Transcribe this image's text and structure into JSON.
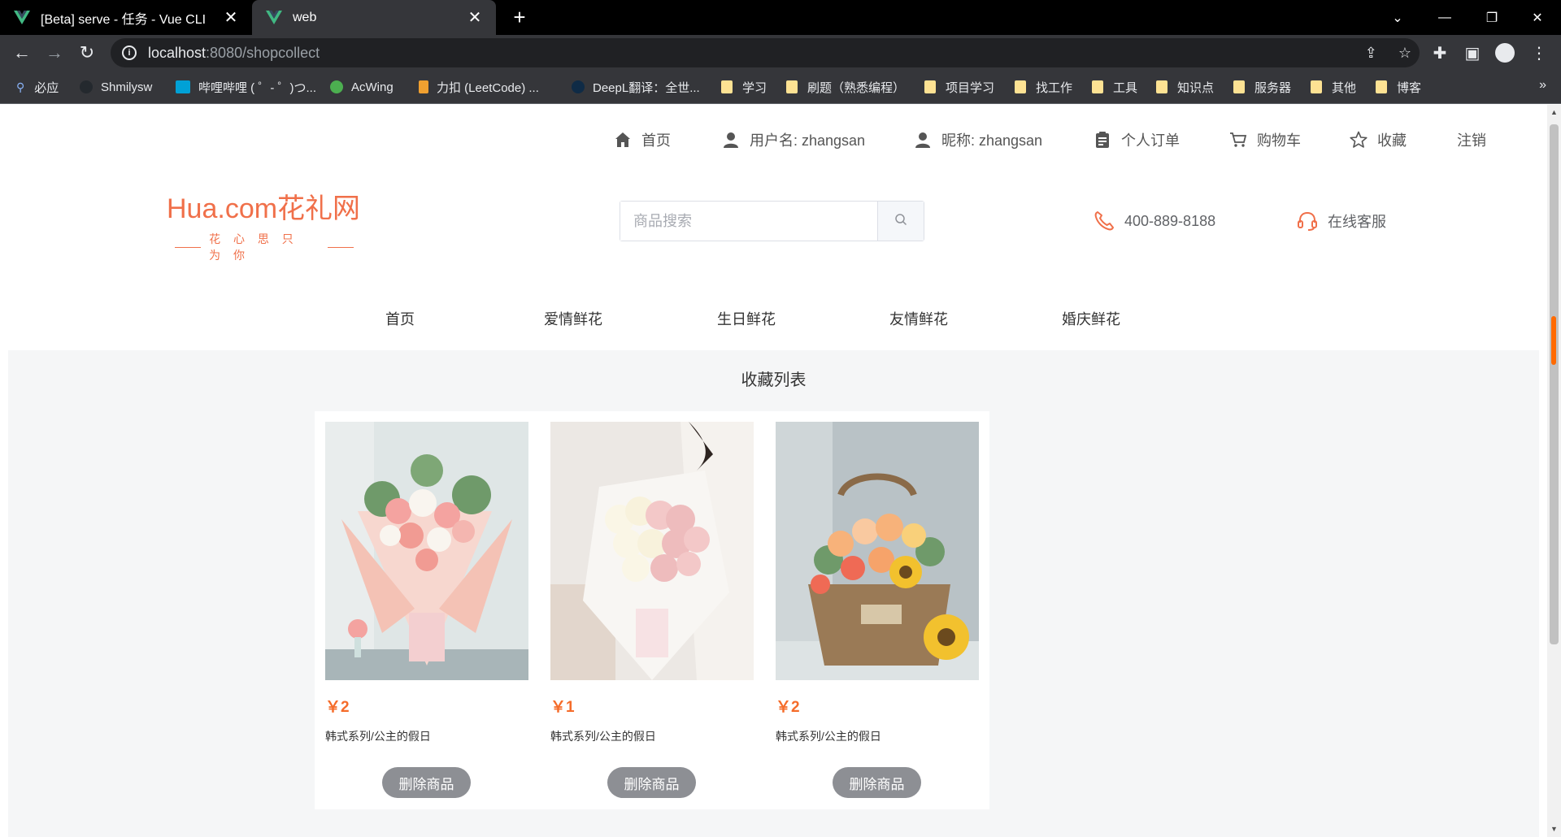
{
  "browser": {
    "tabs": [
      {
        "title": "[Beta] serve - 任务 - Vue CLI",
        "active": false
      },
      {
        "title": "web",
        "active": true
      }
    ],
    "url_host": "localhost",
    "url_path": ":8080/shopcollect",
    "bookmarks": [
      {
        "label": "必应",
        "icon": "search-icon"
      },
      {
        "label": "Shmilysw",
        "icon": "github-icon"
      },
      {
        "label": "哔哩哔哩 ( ゜- ゜)つ...",
        "icon": "bilibili-icon"
      },
      {
        "label": "AcWing",
        "icon": "acwing-icon"
      },
      {
        "label": "力扣 (LeetCode) ...",
        "icon": "leetcode-icon"
      },
      {
        "label": "DeepL翻译：全世...",
        "icon": "deepl-icon"
      },
      {
        "label": "学习",
        "icon": "folder-icon"
      },
      {
        "label": "刷题（熟悉编程）",
        "icon": "folder-icon"
      },
      {
        "label": "项目学习",
        "icon": "folder-icon"
      },
      {
        "label": "找工作",
        "icon": "folder-icon"
      },
      {
        "label": "工具",
        "icon": "folder-icon"
      },
      {
        "label": "知识点",
        "icon": "folder-icon"
      },
      {
        "label": "服务器",
        "icon": "folder-icon"
      },
      {
        "label": "其他",
        "icon": "folder-icon"
      },
      {
        "label": "博客",
        "icon": "folder-icon"
      }
    ]
  },
  "topnav": {
    "home": "首页",
    "username": "用户名: zhangsan",
    "nickname": "昵称: zhangsan",
    "orders": "个人订单",
    "cart": "购物车",
    "collect": "收藏",
    "logout": "注销"
  },
  "header": {
    "logo_main": "Hua.com花礼网",
    "logo_sub": "花 心 思 只 为 你",
    "search_placeholder": "商品搜索",
    "phone": "400-889-8188",
    "service": "在线客服"
  },
  "categories": [
    "首页",
    "爱情鲜花",
    "生日鲜花",
    "友情鲜花",
    "婚庆鲜花"
  ],
  "collect": {
    "title": "收藏列表",
    "items": [
      {
        "price": "￥2",
        "name": "韩式系列/公主的假日",
        "button": "删除商品"
      },
      {
        "price": "￥1",
        "name": "韩式系列/公主的假日",
        "button": "删除商品"
      },
      {
        "price": "￥2",
        "name": "韩式系列/公主的假日",
        "button": "删除商品"
      }
    ]
  },
  "colors": {
    "brand": "#f0704a",
    "price": "#f56c2a",
    "button": "#8d8f94"
  }
}
